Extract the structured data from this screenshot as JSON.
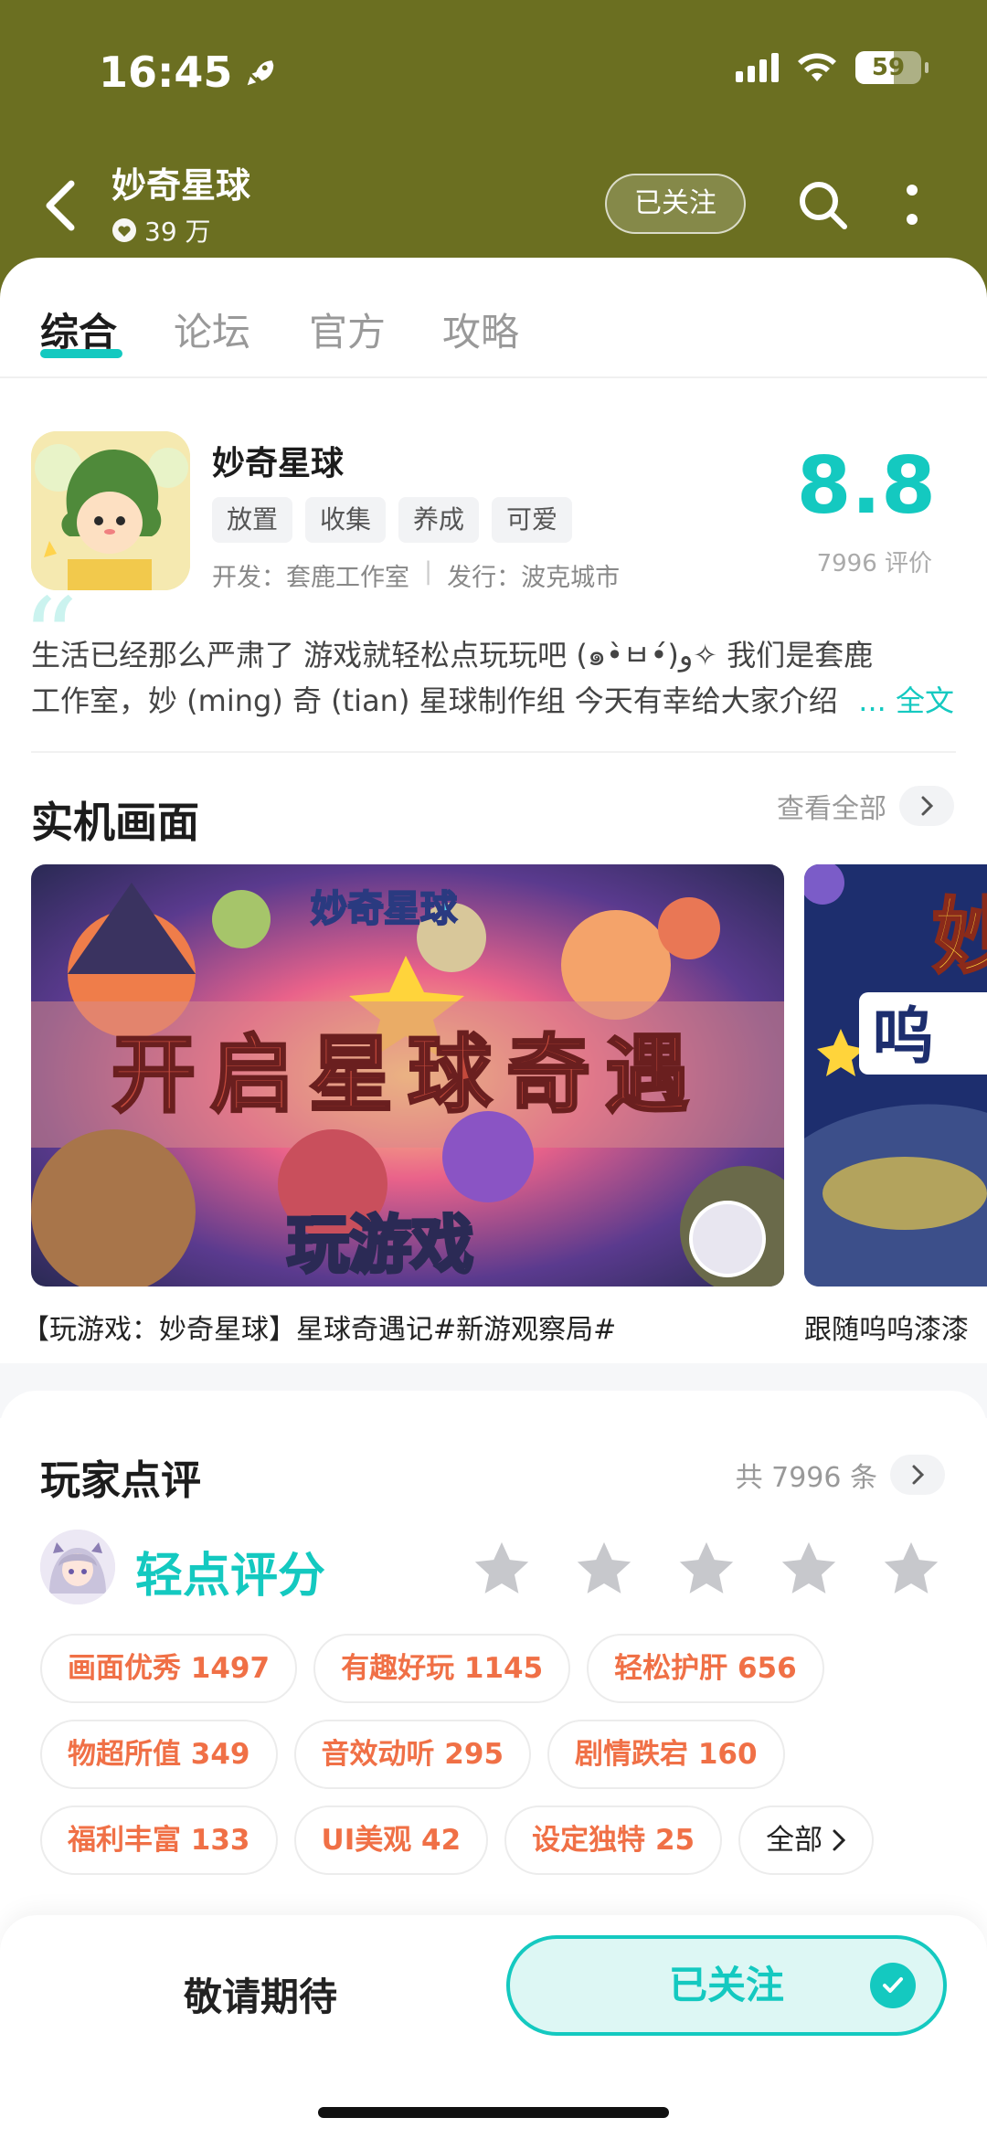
{
  "status_bar": {
    "time": "16:45",
    "battery": "59",
    "battery_level": 0.59
  },
  "header": {
    "title": "妙奇星球",
    "followers": "39 万",
    "follow_state": "已关注"
  },
  "tabs": [
    "综合",
    "论坛",
    "官方",
    "攻略"
  ],
  "game": {
    "name": "妙奇星球",
    "tags": [
      "放置",
      "收集",
      "养成",
      "可爱"
    ],
    "developer_label": "开发：",
    "developer": "套鹿工作室",
    "publisher_label": "发行：",
    "publisher": "波克城市",
    "score": "8.8",
    "rating_count": "7996 评价"
  },
  "intro": {
    "line1": "生活已经那么严肃了  游戏就轻松点玩玩吧 (๑•̀ㅂ•́)و✧    我们是套鹿",
    "line2": "工作室，妙 (ming) 奇 (tian) 星球制作组  今天有幸给大家介绍",
    "more": "... 全文"
  },
  "screenshots": {
    "title": "实机画面",
    "view_all": "查看全部",
    "items": [
      {
        "caption": "【玩游戏：妙奇星球】星球奇遇记#新游观察局#",
        "logo_text": "妙奇星球",
        "banner_text": "开启星球奇遇",
        "bottom_text": "玩游戏"
      },
      {
        "caption": "跟随呜呜漆漆",
        "peek_text": "妙",
        "peek_text2": "呜"
      }
    ]
  },
  "reviews": {
    "title": "玩家点评",
    "count": "共 7996 条",
    "rate_label": "轻点评分",
    "stars": 5,
    "chips": [
      [
        "画面优秀 1497",
        "有趣好玩 1145",
        "轻松护肝 656"
      ],
      [
        "物超所值 349",
        "音效动听 295",
        "剧情跌宕 160"
      ],
      [
        "福利丰富 133",
        "UI美观 42",
        "设定独特 25"
      ]
    ],
    "all_label": "全部"
  },
  "bottom": {
    "expect": "敬请期待",
    "followed": "已关注"
  },
  "colors": {
    "header_bg": "#6b6f21",
    "accent": "#14c9c0",
    "chip_text": "#f07046"
  },
  "icons": [
    "rocket-icon",
    "signal-icon",
    "wifi-icon",
    "battery-icon",
    "back-icon",
    "heart-icon",
    "search-icon",
    "more-icon",
    "chevron-right-icon",
    "star-icon",
    "check-icon"
  ]
}
